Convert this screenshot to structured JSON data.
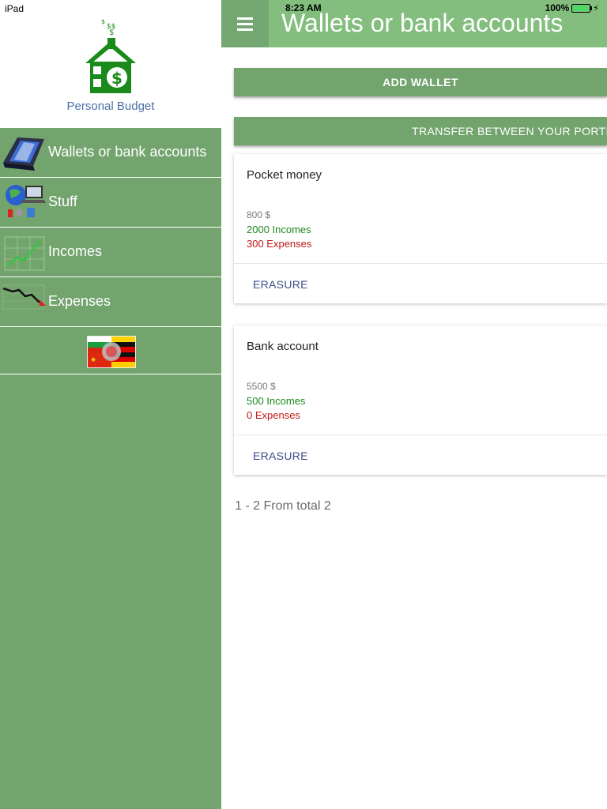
{
  "status": {
    "device": "iPad",
    "time": "8:23 AM",
    "battery": "100%"
  },
  "logo": {
    "text": "Personal Budget"
  },
  "sidebar": {
    "items": [
      {
        "label": "Wallets or bank accounts",
        "icon": "wallet-icon"
      },
      {
        "label": "Stuff",
        "icon": "globe-laptop-icon"
      },
      {
        "label": "Incomes",
        "icon": "rising-chart-icon"
      },
      {
        "label": "Expenses",
        "icon": "falling-chart-icon"
      }
    ],
    "language_icon": "language-flags-icon"
  },
  "header": {
    "title": "Wallets or bank accounts",
    "menu_icon": "hamburger-icon"
  },
  "actions": {
    "add_wallet": "ADD WALLET",
    "transfer": "TRANSFER BETWEEN YOUR PORTFO"
  },
  "wallets": [
    {
      "name": "Pocket money",
      "balance": "800 $",
      "incomes": "2000 Incomes",
      "expenses": "300 Expenses",
      "erase_label": "ERASURE"
    },
    {
      "name": "Bank account",
      "balance": "5500 $",
      "incomes": "500 Incomes",
      "expenses": "0 Expenses",
      "erase_label": "ERASURE"
    }
  ],
  "pagination": "1 - 2 From total 2",
  "colors": {
    "sidebar": "#73a46e",
    "topbar": "#83be7e",
    "income": "#1d8a1d",
    "expense": "#c01818"
  }
}
